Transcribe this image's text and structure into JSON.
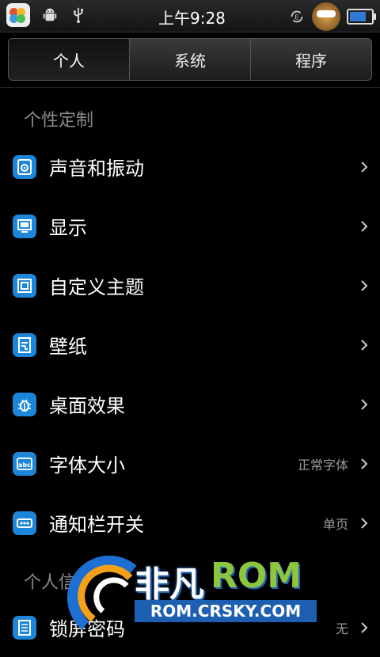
{
  "status": {
    "time": "上午9:28",
    "icons": [
      "app-store-icon",
      "android-icon",
      "usb-icon",
      "sync-icon",
      "avatar",
      "battery-icon"
    ],
    "battery_level": 0.75
  },
  "tabs": [
    {
      "label": "个人",
      "active": true
    },
    {
      "label": "系统",
      "active": false
    },
    {
      "label": "程序",
      "active": false
    }
  ],
  "sections": [
    {
      "title": "个性定制"
    },
    {
      "title": "个人信"
    }
  ],
  "items": [
    {
      "label": "声音和振动",
      "value": "",
      "icon": "speaker-icon"
    },
    {
      "label": "显示",
      "value": "",
      "icon": "display-icon"
    },
    {
      "label": "自定义主题",
      "value": "",
      "icon": "theme-icon"
    },
    {
      "label": "壁纸",
      "value": "",
      "icon": "wallpaper-icon"
    },
    {
      "label": "桌面效果",
      "value": "",
      "icon": "bug-icon"
    },
    {
      "label": "字体大小",
      "value": "正常字体",
      "icon": "font-icon"
    },
    {
      "label": "通知栏开关",
      "value": "单页",
      "icon": "toggle-icon"
    },
    {
      "label": "锁屏密码",
      "value": "无",
      "icon": "lock-icon"
    }
  ],
  "watermark": {
    "brand_a": "非凡",
    "brand_b": "ROM",
    "url": "ROM.CRSKY.COM"
  },
  "colors": {
    "accent": "#1e86d8",
    "background": "#000000",
    "section_text": "#8a8a8a",
    "value_text": "#9a9a9a"
  }
}
